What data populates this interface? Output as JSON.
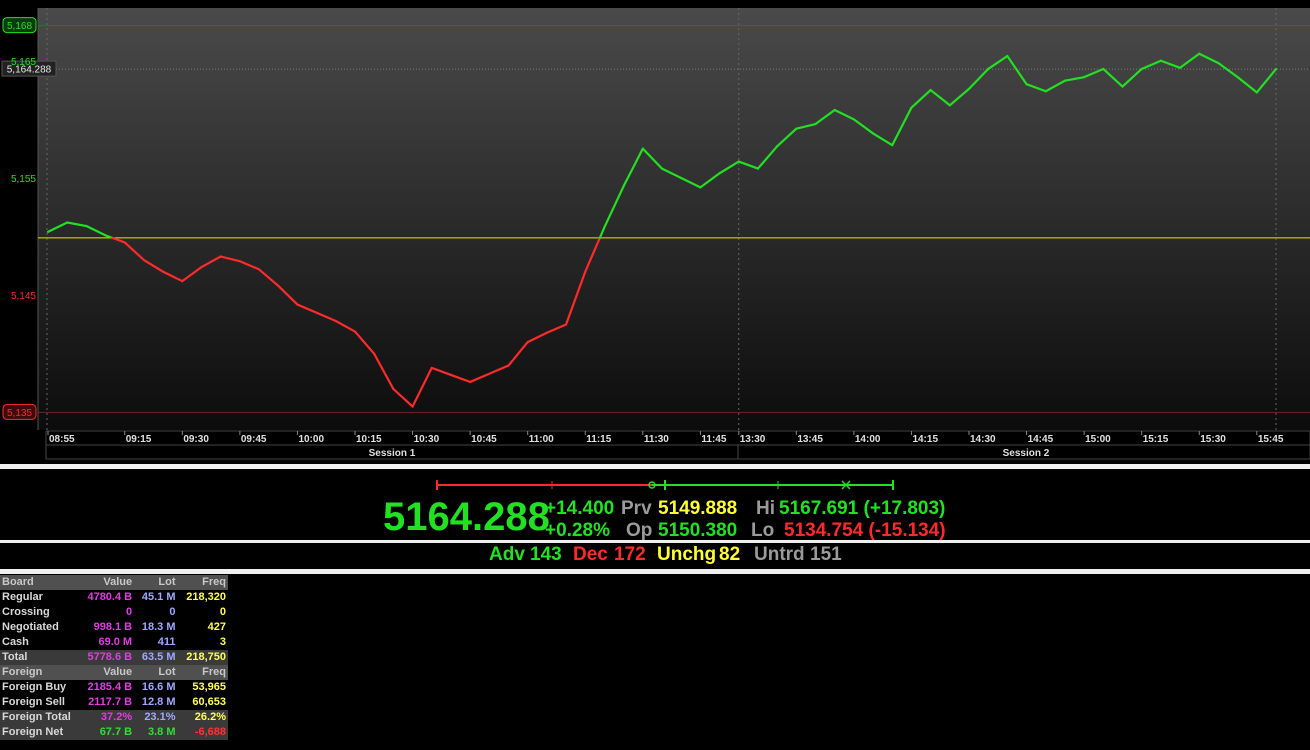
{
  "chart_data": {
    "type": "line",
    "title": "",
    "ylim": [
      5133.5,
      5169.5
    ],
    "y_ticks": [
      "5,135",
      "5,145",
      "5,155",
      "5,165"
    ],
    "y_markers": {
      "high": "5,168",
      "low": "5,135",
      "last": "5,164.288"
    },
    "x_ticks": [
      "08:55",
      "09:15",
      "09:30",
      "09:45",
      "10:00",
      "10:15",
      "10:30",
      "10:45",
      "11:00",
      "11:15",
      "11:30",
      "11:45",
      "13:30",
      "13:45",
      "14:00",
      "14:15",
      "14:30",
      "14:45",
      "15:00",
      "15:15",
      "15:30",
      "15:45"
    ],
    "sessions": [
      "Session 1",
      "Session 2"
    ],
    "previous_close": 5149.888,
    "series_note": "red below previous close, green above",
    "x": [
      "08:55",
      "09:00",
      "09:05",
      "09:10",
      "09:15",
      "09:20",
      "09:25",
      "09:30",
      "09:35",
      "09:40",
      "09:45",
      "09:50",
      "09:55",
      "10:00",
      "10:05",
      "10:10",
      "10:15",
      "10:20",
      "10:25",
      "10:30",
      "10:35",
      "10:40",
      "10:45",
      "10:50",
      "10:55",
      "11:00",
      "11:05",
      "11:10",
      "11:15",
      "11:20",
      "11:25",
      "11:30",
      "11:35",
      "11:40",
      "11:45",
      "11:50",
      "13:30",
      "13:35",
      "13:40",
      "13:45",
      "13:50",
      "13:55",
      "14:00",
      "14:05",
      "14:10",
      "14:15",
      "14:20",
      "14:25",
      "14:30",
      "14:35",
      "14:40",
      "14:45",
      "14:50",
      "14:55",
      "15:00",
      "15:05",
      "15:10",
      "15:15",
      "15:20",
      "15:25",
      "15:30",
      "15:35",
      "15:40",
      "15:45",
      "15:50"
    ],
    "y": [
      5150.4,
      5151.2,
      5150.9,
      5150.1,
      5149.5,
      5148.0,
      5147.0,
      5146.2,
      5147.4,
      5148.3,
      5147.9,
      5147.2,
      5145.8,
      5144.2,
      5143.5,
      5142.8,
      5141.9,
      5140.0,
      5137.0,
      5135.5,
      5138.8,
      5138.2,
      5137.6,
      5138.3,
      5139.0,
      5141.0,
      5141.8,
      5142.5,
      5147.0,
      5150.8,
      5154.3,
      5157.5,
      5155.8,
      5155.0,
      5154.2,
      5155.4,
      5156.4,
      5155.8,
      5157.7,
      5159.2,
      5159.6,
      5160.8,
      5160.0,
      5158.8,
      5157.8,
      5161.0,
      5162.5,
      5161.2,
      5162.6,
      5164.3,
      5165.4,
      5163.0,
      5162.4,
      5163.3,
      5163.6,
      5164.3,
      5162.8,
      5164.3,
      5165.0,
      5164.4,
      5165.6,
      5164.8,
      5163.6,
      5162.3,
      5164.288
    ]
  },
  "quote": {
    "last": "5164.288",
    "change": "+14.400",
    "change_pct": "+0.28%",
    "prv_label": "Prv",
    "prv": "5149.888",
    "op_label": "Op",
    "op": "5150.380",
    "hi_label": "Hi",
    "hi": "5167.691 (+17.803)",
    "lo_label": "Lo",
    "lo": "5134.754 (-15.134)"
  },
  "breadth": {
    "adv_label": "Adv",
    "adv": "143",
    "dec_label": "Dec",
    "dec": "172",
    "unchg_label": "Unchg",
    "unchg": "82",
    "untrd_label": "Untrd",
    "untrd": "151"
  },
  "board": {
    "header": [
      "Board",
      "Value",
      "Lot",
      "Freq"
    ],
    "rows": [
      [
        "Regular",
        "4780.4 B",
        "45.1 M",
        "218,320"
      ],
      [
        "Crossing",
        "0",
        "0",
        "0"
      ],
      [
        "Negotiated",
        "998.1 B",
        "18.3 M",
        "427"
      ],
      [
        "Cash",
        "69.0 M",
        "411",
        "3"
      ]
    ],
    "total": [
      "Total",
      "5778.6 B",
      "63.5 M",
      "218,750"
    ],
    "foreign_header": [
      "Foreign",
      "Value",
      "Lot",
      "Freq"
    ],
    "foreign_rows": [
      [
        "Foreign Buy",
        "2185.4 B",
        "16.6 M",
        "53,965"
      ],
      [
        "Foreign Sell",
        "2117.7 B",
        "12.8 M",
        "60,653"
      ]
    ],
    "foreign_total": [
      "Foreign Total",
      "37.2%",
      "23.1%",
      "26.2%"
    ],
    "foreign_net": [
      "Foreign Net",
      "67.7 B",
      "3.8 M",
      "-6,688"
    ]
  },
  "colors": {
    "up": "#22e022",
    "down": "#ff2a2a",
    "prev_close_line": "#e6e600",
    "high_line": "#1f7a1f",
    "low_line": "#7a1f1f"
  }
}
